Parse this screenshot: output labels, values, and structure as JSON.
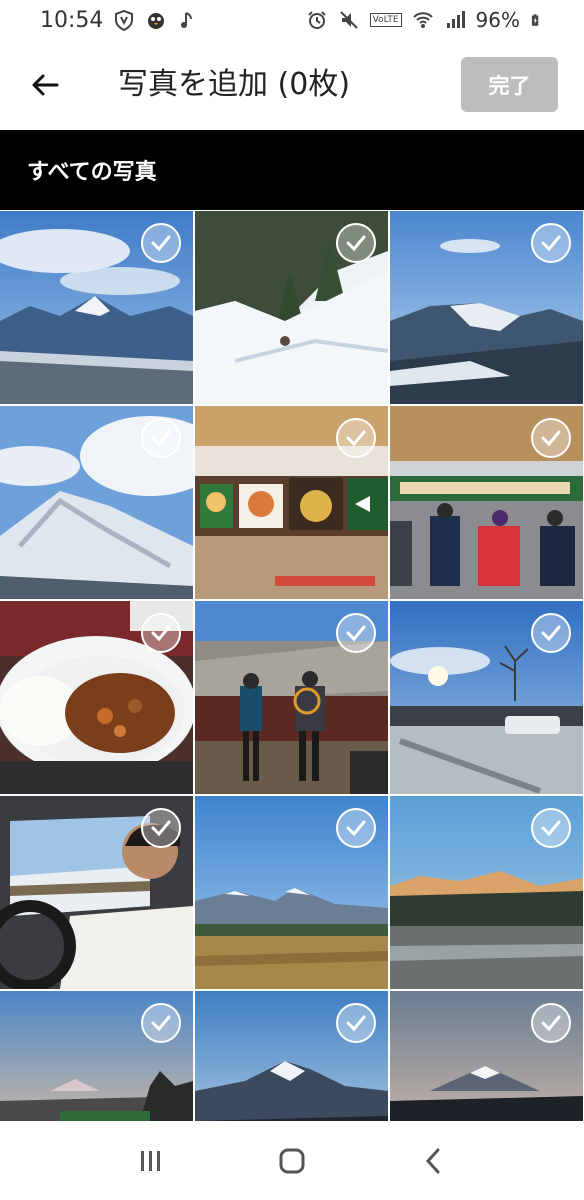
{
  "status": {
    "time": "10:54",
    "battery": "96%",
    "left_icons": [
      "shield-icon",
      "penguin-icon",
      "music-icon"
    ],
    "right_icons": [
      "alarm-icon",
      "mute-icon",
      "volte-icon",
      "wifi-icon",
      "signal-icon",
      "battery-icon"
    ],
    "volte_label": "VoLTE"
  },
  "app_bar": {
    "back_icon": "arrow-left-icon",
    "title": "写真を追加 (0枚)",
    "done_label": "完了"
  },
  "section": {
    "title": "すべての写真"
  },
  "photos": [
    {
      "id": "snowy-peak-blue-sky",
      "selected": false
    },
    {
      "id": "snowy-forest-slope",
      "selected": false
    },
    {
      "id": "mountain-ridge-snow",
      "selected": false
    },
    {
      "id": "snow-summit-clouds",
      "selected": false
    },
    {
      "id": "food-court-menu-signs",
      "selected": false
    },
    {
      "id": "food-court-queue",
      "selected": false
    },
    {
      "id": "curry-rice-plate",
      "selected": false
    },
    {
      "id": "hikers-on-deck",
      "selected": false
    },
    {
      "id": "sunny-parking-lot",
      "selected": false
    },
    {
      "id": "driver-in-car",
      "selected": false
    },
    {
      "id": "alps-over-field",
      "selected": false
    },
    {
      "id": "sunlit-peaks-town",
      "selected": false
    },
    {
      "id": "fuji-highway-dusk",
      "selected": false
    },
    {
      "id": "snow-mountain-twilight",
      "selected": false
    },
    {
      "id": "fuji-twilight",
      "selected": false
    }
  ],
  "nav": {
    "recents_icon": "recents-icon",
    "home_icon": "home-icon",
    "back_icon": "nav-back-icon"
  },
  "colors": {
    "header_bg": "#000000",
    "done_bg": "#bdbdbd"
  }
}
